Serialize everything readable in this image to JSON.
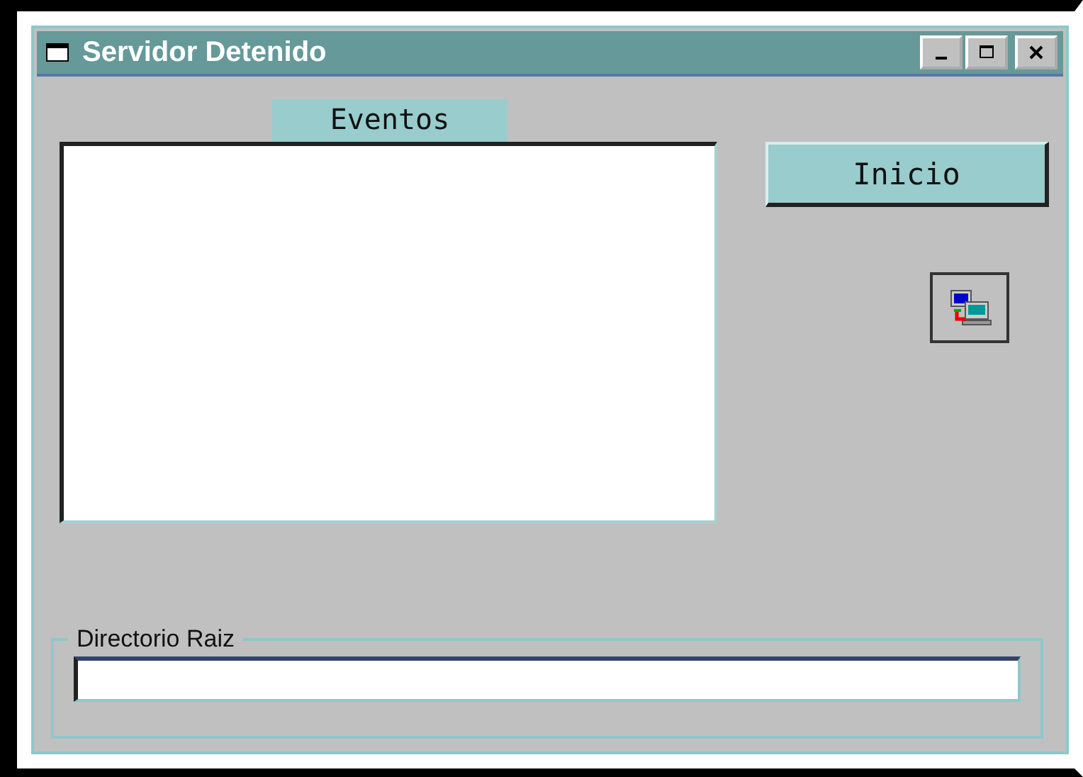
{
  "window": {
    "title": "Servidor Detenido"
  },
  "events": {
    "label": "Eventos"
  },
  "buttons": {
    "start": "Inicio"
  },
  "root_directory": {
    "label": "Directorio Raiz"
  }
}
